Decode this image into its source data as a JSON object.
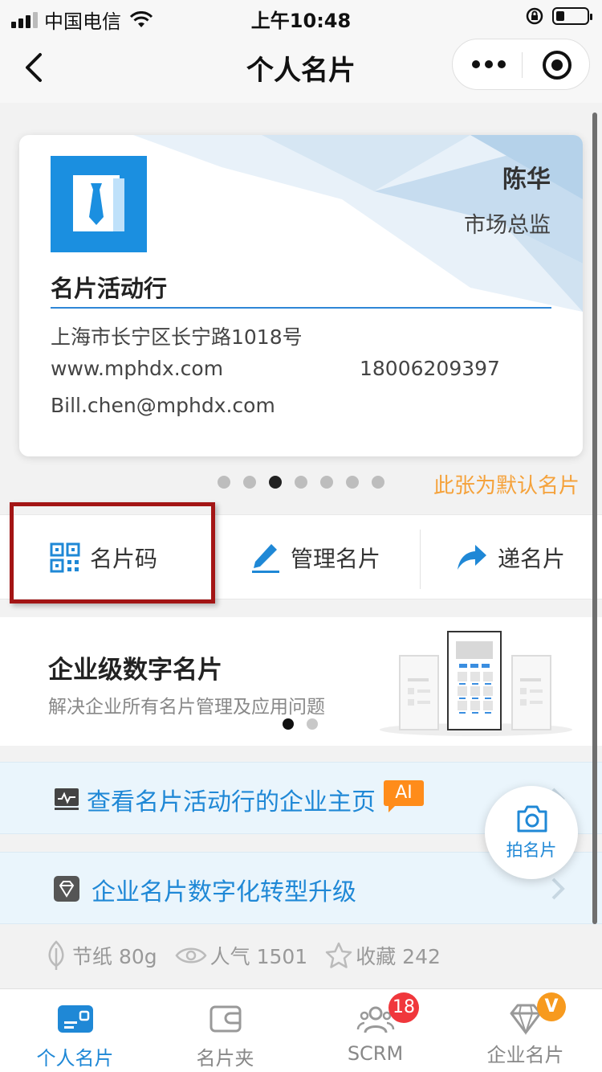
{
  "status_bar": {
    "carrier": "中国电信",
    "time": "上午10:48"
  },
  "nav": {
    "title": "个人名片"
  },
  "card": {
    "name": "陈华",
    "title": "市场总监",
    "company": "名片活动行",
    "address": "上海市长宁区长宁路1018号",
    "website": "www.mphdx.com",
    "phone": "18006209397",
    "email": "Bill.chen@mphdx.com",
    "pager": {
      "count": 7,
      "active_index": 2
    },
    "default_note": "此张为默认名片"
  },
  "actions": [
    {
      "label": "名片码",
      "icon": "qr-code-icon"
    },
    {
      "label": "管理名片",
      "icon": "pencil-icon"
    },
    {
      "label": "递名片",
      "icon": "share-arrow-icon"
    }
  ],
  "banner": {
    "title": "企业级数字名片",
    "subtitle": "解决企业所有名片管理及应用问题",
    "dots": {
      "count": 2,
      "active_index": 0
    }
  },
  "links": [
    {
      "text": "查看名片活动行的企业主页",
      "badge": "AI",
      "icon": "monitor-icon"
    },
    {
      "text": "企业名片数字化转型升级",
      "icon": "diamond-icon"
    }
  ],
  "fab": {
    "label": "拍名片",
    "icon": "camera-icon"
  },
  "stats": {
    "paper": "节纸 80g",
    "popularity": "人气 1501",
    "favorites": "收藏 242"
  },
  "tabs": [
    {
      "label": "个人名片",
      "icon": "card-icon",
      "active": true
    },
    {
      "label": "名片夹",
      "icon": "wallet-icon",
      "active": false
    },
    {
      "label": "SCRM",
      "icon": "people-icon",
      "active": false,
      "badge": "18"
    },
    {
      "label": "企业名片",
      "icon": "diamond-icon",
      "active": false,
      "badge": "V"
    }
  ],
  "colors": {
    "accent": "#1f88d6",
    "orange": "#f5a23b",
    "highlight_border": "#a31515",
    "badge_red": "#f0373c"
  }
}
